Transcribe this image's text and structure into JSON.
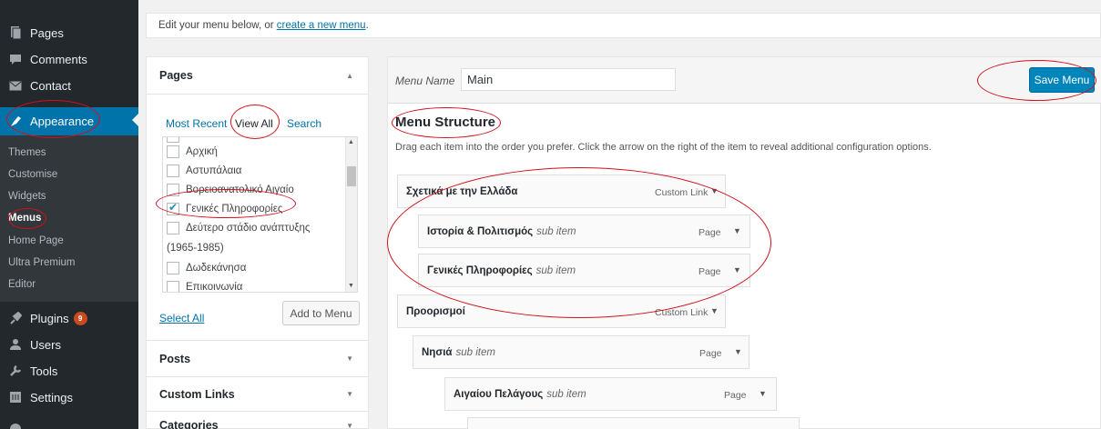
{
  "sidebar": {
    "items": [
      {
        "label": "Pages",
        "icon": "pages-icon"
      },
      {
        "label": "Comments",
        "icon": "comments-icon"
      },
      {
        "label": "Contact",
        "icon": "envelope-icon"
      },
      {
        "label": "Appearance",
        "icon": "paintbrush-icon"
      },
      {
        "label": "Plugins",
        "icon": "plugin-icon",
        "badge": "9"
      },
      {
        "label": "Users",
        "icon": "users-icon"
      },
      {
        "label": "Tools",
        "icon": "wrench-icon"
      },
      {
        "label": "Settings",
        "icon": "settings-icon"
      }
    ],
    "submenu": [
      "Themes",
      "Customise",
      "Widgets",
      "Menus",
      "Home Page",
      "Ultra Premium",
      "Editor"
    ]
  },
  "notice": {
    "text": "Edit your menu below, or ",
    "link": "create a new menu",
    "suffix": "."
  },
  "accordion": {
    "pages_title": "Pages",
    "tabs": [
      "Most Recent",
      "View All",
      "Search"
    ],
    "pages": [
      {
        "label": "Αρχική",
        "checked": false
      },
      {
        "label": "Αστυπάλαια",
        "checked": false
      },
      {
        "label": "Βορειοανατολικό Αιγαίο",
        "checked": false
      },
      {
        "label": "Γενικές Πληροφορίες",
        "checked": true
      },
      {
        "label": "Δεύτερο στάδιο ανάπτυξης",
        "checked": false,
        "wrap": "(1965-1985)"
      },
      {
        "label": "Δωδεκάνησα",
        "checked": false
      },
      {
        "label": "Επικοινωνία",
        "checked": false
      }
    ],
    "select_all": "Select All",
    "add_to_menu": "Add to Menu",
    "sections": [
      "Posts",
      "Custom Links",
      "Categories"
    ]
  },
  "editor": {
    "menu_name_label": "Menu Name",
    "menu_name_value": "Main",
    "save_label": "Save Menu",
    "structure_title": "Menu Structure",
    "instructions": "Drag each item into the order you prefer. Click the arrow on the right of the item to reveal additional configuration options.",
    "items": [
      {
        "title": "Σχετικά με την Ελλάδα",
        "sub": "",
        "type": "Custom Link",
        "depth": 0
      },
      {
        "title": "Ιστορία & Πολιτισμός",
        "sub": "sub item",
        "type": "Page",
        "depth": 1
      },
      {
        "title": "Γενικές Πληροφορίες",
        "sub": "sub item",
        "type": "Page",
        "depth": 1
      },
      {
        "title": "Προορισμοί",
        "sub": "",
        "type": "Custom Link",
        "depth": 0
      },
      {
        "title": "Νησιά",
        "sub": "sub item",
        "type": "Page",
        "depth": 1
      },
      {
        "title": "Αιγαίου Πελάγους",
        "sub": "sub item",
        "type": "Page",
        "depth": 2
      }
    ]
  },
  "colors": {
    "sidebar_bg": "#23282d",
    "accent": "#0073aa",
    "button": "#0085ba",
    "annotation": "#d0111b"
  }
}
